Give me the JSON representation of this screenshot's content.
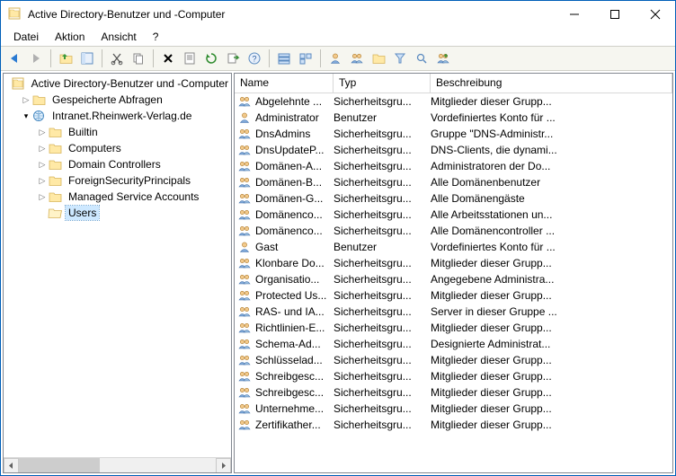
{
  "window": {
    "title": "Active Directory-Benutzer und -Computer"
  },
  "menu": {
    "file": "Datei",
    "action": "Aktion",
    "view": "Ansicht",
    "help": "?"
  },
  "tree": {
    "root": "Active Directory-Benutzer und -Computer",
    "saved_queries": "Gespeicherte Abfragen",
    "domain": "Intranet.Rheinwerk-Verlag.de",
    "builtin": "Builtin",
    "computers": "Computers",
    "domain_controllers": "Domain Controllers",
    "fsp": "ForeignSecurityPrincipals",
    "msa": "Managed Service Accounts",
    "users": "Users"
  },
  "columns": {
    "name": "Name",
    "type": "Typ",
    "desc": "Beschreibung"
  },
  "rows": [
    {
      "icon": "group",
      "name": "Abgelehnte ...",
      "type": "Sicherheitsgru...",
      "desc": "Mitglieder dieser Grupp..."
    },
    {
      "icon": "user",
      "name": "Administrator",
      "type": "Benutzer",
      "desc": "Vordefiniertes Konto für ..."
    },
    {
      "icon": "group",
      "name": "DnsAdmins",
      "type": "Sicherheitsgru...",
      "desc": "Gruppe \"DNS-Administr..."
    },
    {
      "icon": "group",
      "name": "DnsUpdateP...",
      "type": "Sicherheitsgru...",
      "desc": "DNS-Clients, die dynami..."
    },
    {
      "icon": "group",
      "name": "Domänen-A...",
      "type": "Sicherheitsgru...",
      "desc": "Administratoren der Do..."
    },
    {
      "icon": "group",
      "name": "Domänen-B...",
      "type": "Sicherheitsgru...",
      "desc": "Alle Domänenbenutzer"
    },
    {
      "icon": "group",
      "name": "Domänen-G...",
      "type": "Sicherheitsgru...",
      "desc": "Alle Domänengäste"
    },
    {
      "icon": "group",
      "name": "Domänenco...",
      "type": "Sicherheitsgru...",
      "desc": "Alle Arbeitsstationen un..."
    },
    {
      "icon": "group",
      "name": "Domänenco...",
      "type": "Sicherheitsgru...",
      "desc": "Alle Domänencontroller ..."
    },
    {
      "icon": "user",
      "name": "Gast",
      "type": "Benutzer",
      "desc": "Vordefiniertes Konto für ..."
    },
    {
      "icon": "group",
      "name": "Klonbare Do...",
      "type": "Sicherheitsgru...",
      "desc": "Mitglieder dieser Grupp..."
    },
    {
      "icon": "group",
      "name": "Organisatio...",
      "type": "Sicherheitsgru...",
      "desc": "Angegebene Administra..."
    },
    {
      "icon": "group",
      "name": "Protected Us...",
      "type": "Sicherheitsgru...",
      "desc": "Mitglieder dieser Grupp..."
    },
    {
      "icon": "group",
      "name": "RAS- und IA...",
      "type": "Sicherheitsgru...",
      "desc": "Server in dieser Gruppe ..."
    },
    {
      "icon": "group",
      "name": "Richtlinien-E...",
      "type": "Sicherheitsgru...",
      "desc": "Mitglieder dieser Grupp..."
    },
    {
      "icon": "group",
      "name": "Schema-Ad...",
      "type": "Sicherheitsgru...",
      "desc": "Designierte Administrat..."
    },
    {
      "icon": "group",
      "name": "Schlüsselad...",
      "type": "Sicherheitsgru...",
      "desc": "Mitglieder dieser Grupp..."
    },
    {
      "icon": "group",
      "name": "Schreibgesc...",
      "type": "Sicherheitsgru...",
      "desc": "Mitglieder dieser Grupp..."
    },
    {
      "icon": "group",
      "name": "Schreibgesc...",
      "type": "Sicherheitsgru...",
      "desc": "Mitglieder dieser Grupp..."
    },
    {
      "icon": "group",
      "name": "Unternehme...",
      "type": "Sicherheitsgru...",
      "desc": "Mitglieder dieser Grupp..."
    },
    {
      "icon": "group",
      "name": "Zertifikather...",
      "type": "Sicherheitsgru...",
      "desc": "Mitglieder dieser Grupp..."
    }
  ]
}
